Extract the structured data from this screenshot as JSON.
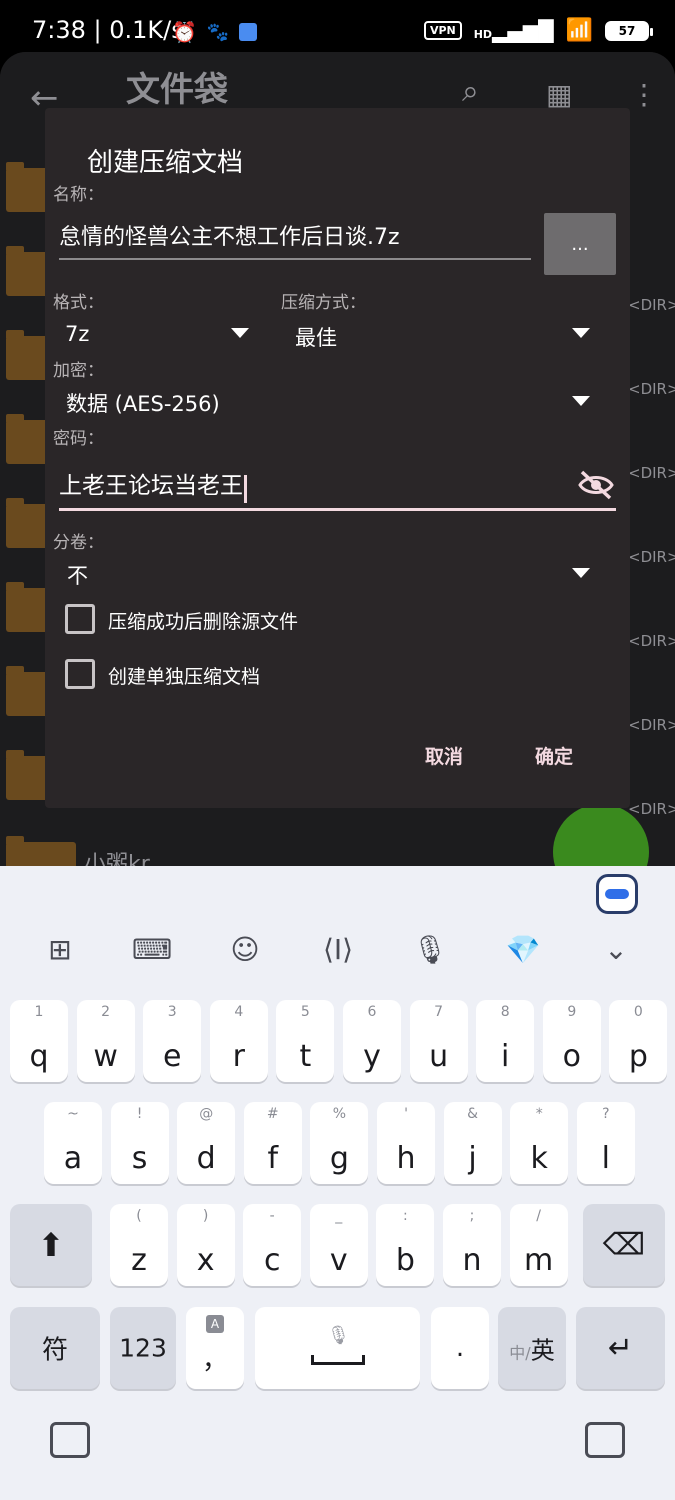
{
  "status_bar": {
    "time": "7:38",
    "speed": "0.1K/s",
    "vpn": "VPN",
    "network": "HD",
    "battery": "57"
  },
  "app": {
    "title": "文件袋",
    "dir_tag": "<DIR>",
    "partial_folder_name": "小粥kr"
  },
  "dialog": {
    "title": "创建压缩文档",
    "name_label": "名称：",
    "name_value": "怠情的怪兽公主不想工作后日谈.7z",
    "browse_label": "...",
    "format_label": "格式：",
    "format_value": "7z",
    "method_label": "压缩方式：",
    "method_value": "最佳",
    "encryption_label": "加密：",
    "encryption_value": "数据 (AES-256)",
    "password_label": "密码：",
    "password_value": "上老王论坛当老王",
    "split_label": "分卷：",
    "split_value": "不",
    "checkbox_delete": "压缩成功后删除源文件",
    "checkbox_separate": "创建单独压缩文档",
    "cancel": "取消",
    "ok": "确定"
  },
  "keyboard": {
    "row1": [
      {
        "k": "q",
        "s": "1"
      },
      {
        "k": "w",
        "s": "2"
      },
      {
        "k": "e",
        "s": "3"
      },
      {
        "k": "r",
        "s": "4"
      },
      {
        "k": "t",
        "s": "5"
      },
      {
        "k": "y",
        "s": "6"
      },
      {
        "k": "u",
        "s": "7"
      },
      {
        "k": "i",
        "s": "8"
      },
      {
        "k": "o",
        "s": "9"
      },
      {
        "k": "p",
        "s": "0"
      }
    ],
    "row2": [
      {
        "k": "a",
        "s": "~"
      },
      {
        "k": "s",
        "s": "!"
      },
      {
        "k": "d",
        "s": "@"
      },
      {
        "k": "f",
        "s": "#"
      },
      {
        "k": "g",
        "s": "%"
      },
      {
        "k": "h",
        "s": "'"
      },
      {
        "k": "j",
        "s": "&"
      },
      {
        "k": "k",
        "s": "*"
      },
      {
        "k": "l",
        "s": "?"
      }
    ],
    "row3": [
      {
        "k": "z",
        "s": "("
      },
      {
        "k": "x",
        "s": ")"
      },
      {
        "k": "c",
        "s": "-"
      },
      {
        "k": "v",
        "s": "_"
      },
      {
        "k": "b",
        "s": ":"
      },
      {
        "k": "n",
        "s": ";"
      },
      {
        "k": "m",
        "s": "/"
      }
    ],
    "symbol_key": "符",
    "num_key": "123",
    "comma_key": "，",
    "comma_badge": "A",
    "period_key": ".",
    "lang_key_small": "中/",
    "lang_key_big": "英"
  }
}
